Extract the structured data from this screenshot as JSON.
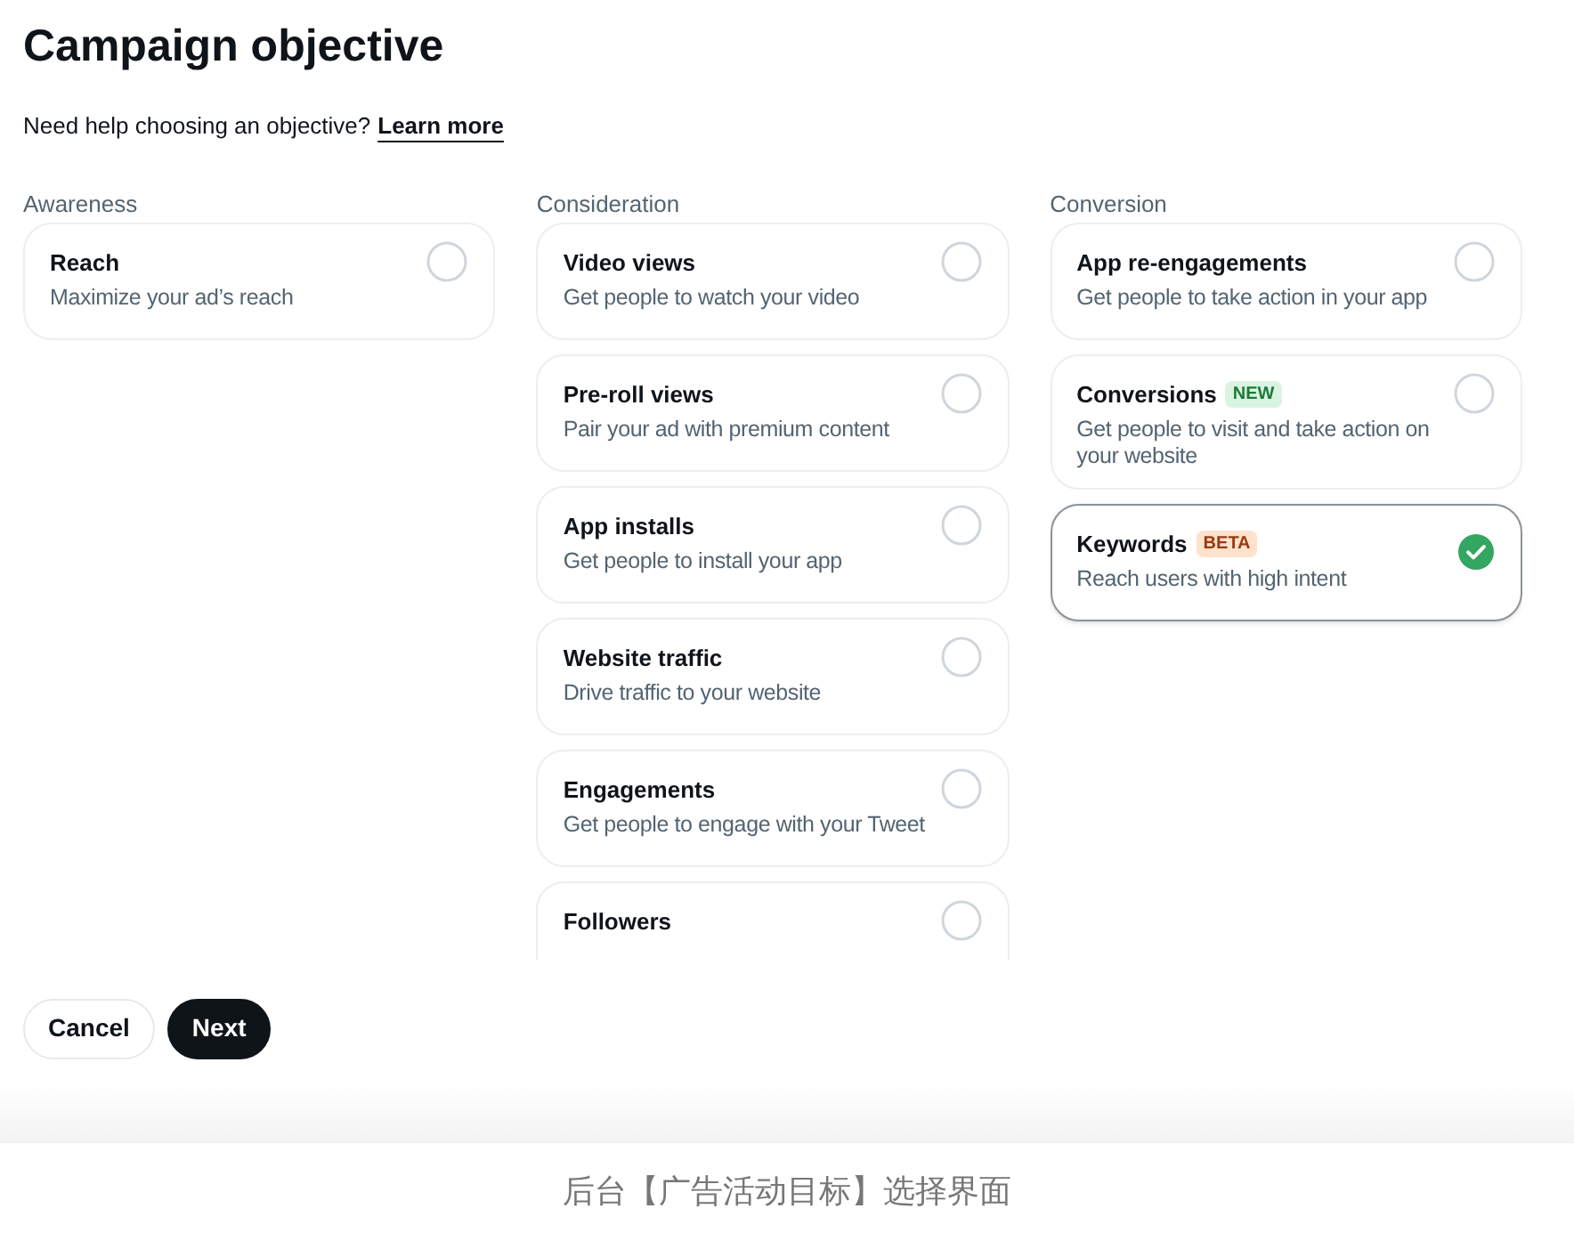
{
  "title": "Campaign objective",
  "help": {
    "text": "Need help choosing an objective?",
    "link": "Learn more"
  },
  "columns": [
    {
      "heading": "Awareness",
      "options": [
        {
          "title": "Reach",
          "description": "Maximize your ad’s reach",
          "selected": false
        }
      ]
    },
    {
      "heading": "Consideration",
      "options": [
        {
          "title": "Video views",
          "description": "Get people to watch your video",
          "selected": false
        },
        {
          "title": "Pre-roll views",
          "description": "Pair your ad with premium content",
          "selected": false
        },
        {
          "title": "App installs",
          "description": "Get people to install your app",
          "selected": false
        },
        {
          "title": "Website traffic",
          "description": "Drive traffic to your website",
          "selected": false
        },
        {
          "title": "Engagements",
          "description": "Get people to engage with your Tweet",
          "selected": false
        },
        {
          "title": "Followers",
          "selected": false
        }
      ]
    },
    {
      "heading": "Conversion",
      "options": [
        {
          "title": "App re-engagements",
          "description": "Get people to take action in your app",
          "selected": false
        },
        {
          "title": "Conversions",
          "badge": {
            "text": "NEW",
            "kind": "new"
          },
          "description": "Get people to visit and take action on your website",
          "selected": false
        },
        {
          "title": "Keywords",
          "badge": {
            "text": "BETA",
            "kind": "beta"
          },
          "description": "Reach users with high intent",
          "selected": true
        }
      ]
    }
  ],
  "buttons": [
    {
      "label": "Cancel",
      "kind": "secondary"
    },
    {
      "label": "Next",
      "kind": "primary"
    }
  ],
  "caption": "后台【广告活动目标】选择界面"
}
